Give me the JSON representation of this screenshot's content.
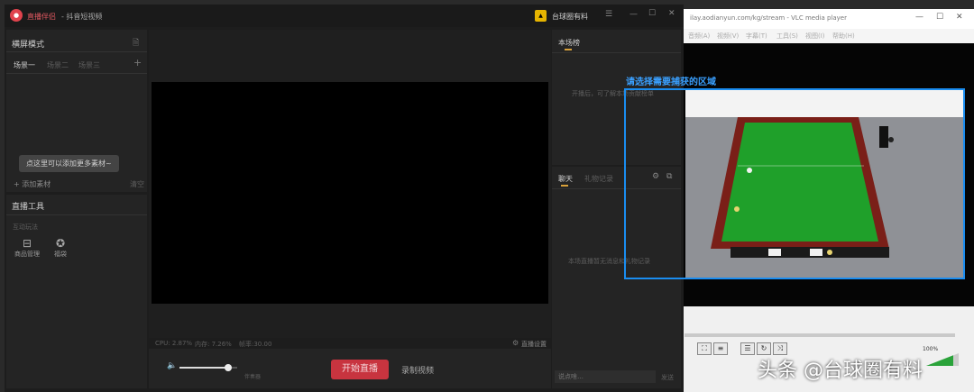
{
  "app": {
    "name": "直播伴侣",
    "subtitle": "- 抖音短视频",
    "user_name": "台球圈有料",
    "window_controls": [
      "☰",
      "—",
      "☐",
      "✕"
    ],
    "left_panel": {
      "title": "横屏模式",
      "scene_tabs": [
        "场景一",
        "场景二",
        "场景三"
      ],
      "tooltip": "点这里可以添加更多素材~",
      "add_material": "+ 添加素材",
      "clear_label": "清空",
      "tools_title": "直播工具",
      "interaction_label": "互动玩法",
      "tools": [
        {
          "label": "商品管理",
          "icon": "store-icon"
        },
        {
          "label": "福袋",
          "icon": "gift-star-icon"
        }
      ]
    },
    "stats": {
      "cpu": "CPU: 2.87%",
      "memory": "内存: 7.26%",
      "fps": "帧率:30.00",
      "live_settings": "直播设置"
    },
    "bottom_bar": {
      "mic_label": "伴奏器",
      "volume_level": 0.85,
      "start_live": "开始直播",
      "record": "录制视频"
    },
    "right_panel": {
      "top_tab": "本场榜",
      "top_empty": "开播后，可了解本场贡献榜单",
      "chat_tab": "聊天",
      "gift_tab": "礼物记录",
      "chat_empty": "本场直播暂无消息和礼物记录",
      "chat_placeholder": "说点啥…",
      "send": "发送"
    }
  },
  "vlc": {
    "title": "ilay.aodianyun.com/kg/stream - VLC media player",
    "menus": [
      "音频(A)",
      "视频(V)",
      "字幕(T)",
      "工具(S)",
      "视图(I)",
      "帮助(H)"
    ],
    "window_controls": [
      "—",
      "☐",
      "✕"
    ],
    "volume_percent": "100%"
  },
  "capture": {
    "label": "请选择需要捕获的区域"
  },
  "watermark": "头条 @台球圈有料",
  "colors": {
    "accent_gold": "#d9a13b",
    "start_red": "#c8343f",
    "capture_blue": "#1a8df0",
    "table_green": "#1fa02a"
  }
}
